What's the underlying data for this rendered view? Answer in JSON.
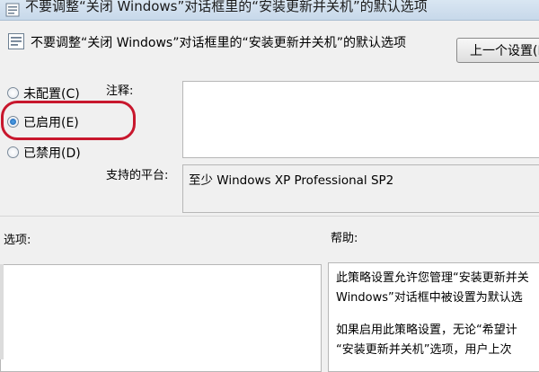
{
  "window": {
    "title": "不要调整“关闭 Windows”对话框里的“安装更新并关机”的默认选项"
  },
  "header": {
    "policy_title": "不要调整“关闭 Windows”对话框里的“安装更新并关机”的默认选项",
    "prev_button": "上一个设置(P)"
  },
  "radios": [
    {
      "label": "未配置(C)",
      "selected": false
    },
    {
      "label": "已启用(E)",
      "selected": true
    },
    {
      "label": "已禁用(D)",
      "selected": false
    }
  ],
  "comment": {
    "label": "注释:",
    "value": ""
  },
  "platform": {
    "label": "支持的平台:",
    "value": "至少 Windows XP Professional SP2"
  },
  "options": {
    "label": "选项:"
  },
  "help": {
    "label": "帮助:",
    "lines": [
      "此策略设置允许您管理“安装更新并关",
      "Windows”对话框中被设置为默认选",
      "如果启用此策略设置，无论“希望计",
      "“安装更新并关机”选项，用户上次"
    ]
  },
  "colors": {
    "highlight_ring": "#c8172d",
    "radio_selected": "#1b5fae"
  }
}
